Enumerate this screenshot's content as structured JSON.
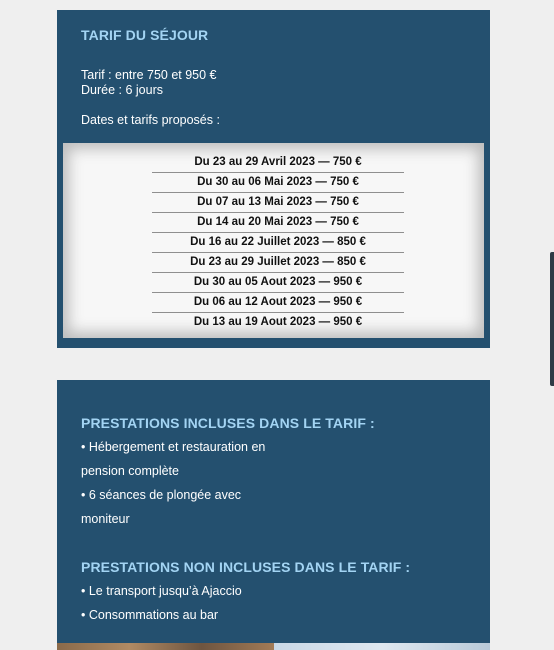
{
  "tarif": {
    "title": "TARIF DU SÉJOUR",
    "price_line": "Tarif : entre 750 et 950 €",
    "duration_line": "Durée : 6 jours",
    "dates_intro": "Dates et tarifs proposés :",
    "dates": [
      "Du 23 au 29 Avril 2023 — 750 €",
      "Du 30 au 06 Mai 2023 — 750 €",
      "Du 07 au 13 Mai 2023 — 750 €",
      "Du 14 au 20 Mai 2023 — 750 €",
      "Du 16 au 22 Juillet 2023 — 850 €",
      "Du 23 au 29 Juillet 2023 — 850 €",
      "Du 30 au 05 Aout 2023 — 950 €",
      "Du 06 au 12 Aout 2023 — 950 €",
      "Du 13 au 19 Aout 2023 — 950 €"
    ]
  },
  "prestations": {
    "included_title": "PRESTATIONS INCLUSES DANS LE TARIF :",
    "included": [
      "• Hébergement et restauration en",
      "pension complète",
      "• 6 séances de plongée avec",
      "moniteur"
    ],
    "excluded_title": "PRESTATIONS NON INCLUSES DANS LE TARIF :",
    "excluded": [
      "• Le transport jusqu’à Ajaccio",
      "• Consommations au bar"
    ]
  },
  "colors": {
    "panel_bg": "#24506f",
    "heading": "#a3d4f3",
    "page_bg": "#efefef"
  }
}
